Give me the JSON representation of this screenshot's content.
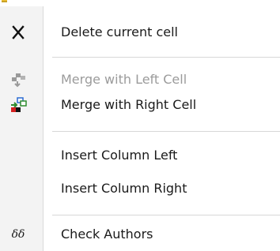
{
  "menu": {
    "items": [
      {
        "label": "Delete current cell",
        "icon": "close-x-icon",
        "enabled": true
      },
      {
        "label": "Merge with Left Cell",
        "icon": "merge-left-icon",
        "enabled": false
      },
      {
        "label": "Merge with Right Cell",
        "icon": "merge-right-icon",
        "enabled": true
      },
      {
        "label": "Insert Column Left",
        "icon": null,
        "enabled": true
      },
      {
        "label": "Insert Column Right",
        "icon": null,
        "enabled": true
      },
      {
        "label": "Check Authors",
        "icon": "glasses-icon",
        "enabled": true
      }
    ],
    "glasses_glyph": "δδ"
  },
  "colors": {
    "text": "#1a1a1a",
    "disabled_text": "#9b9b9b",
    "gutter_bg": "#f3f3f3",
    "separator": "#d8d8d8",
    "accent_green": "#2e8b2e",
    "accent_red": "#d42020",
    "accent_blue": "#2a6bd1"
  }
}
